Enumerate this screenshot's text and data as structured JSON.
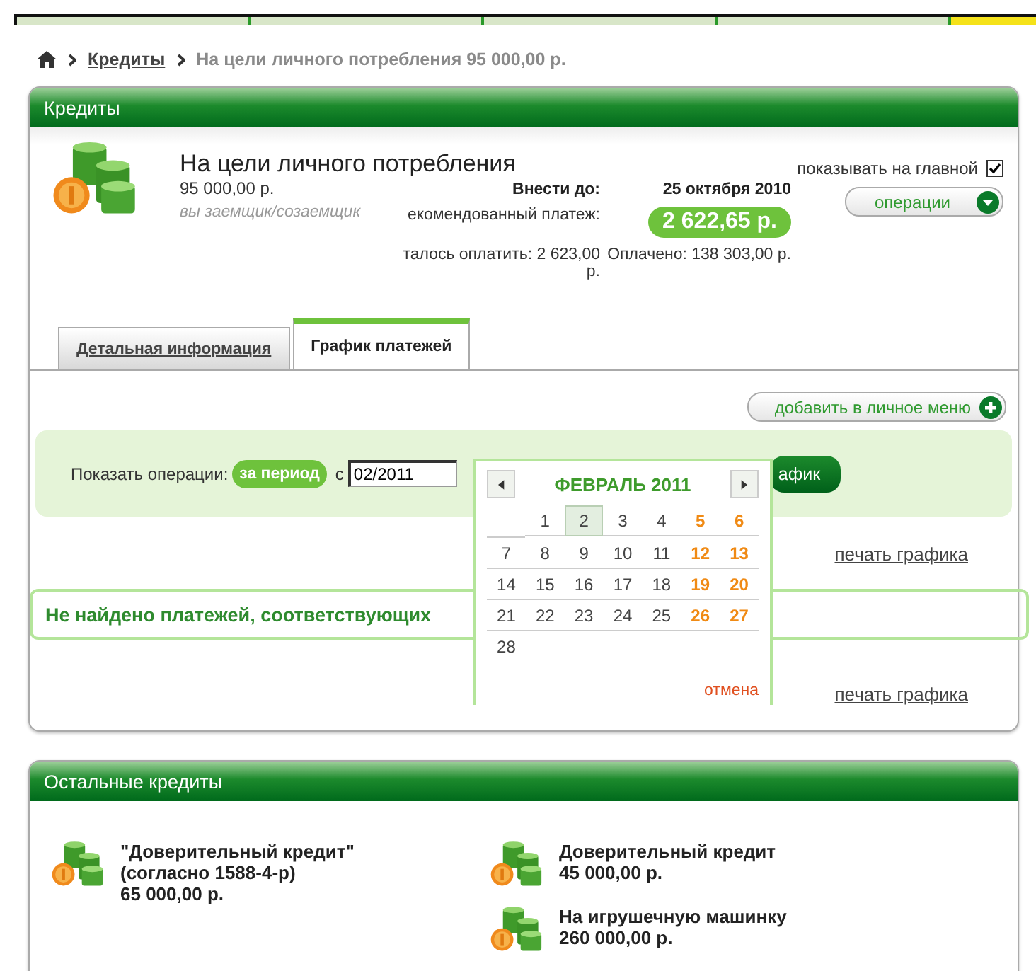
{
  "breadcrumb": {
    "link": "Кредиты",
    "current": "На цели личного потребления 95 000,00 р."
  },
  "panel_title": "Кредиты",
  "loan": {
    "title": "На цели личного потребления",
    "amount": "95 000,00 р.",
    "role": "вы заемщик/созаемщик",
    "info": [
      {
        "label": "Внести до:",
        "value": "25 октября 2010",
        "kind": "bold"
      },
      {
        "label": "екомендованный платеж:",
        "value": "2 622,65 р.",
        "kind": "badge"
      },
      {
        "label": "талось оплатить: 2 623,00 р.",
        "value": "Оплачено: 138 303,00 р.",
        "kind": "plain"
      }
    ],
    "show_on_main": {
      "label": "показывать на главной",
      "checked": true
    },
    "operations_button": "операции"
  },
  "tabs": [
    {
      "label": "Детальная информация",
      "selected": false
    },
    {
      "label": "График платежей",
      "selected": true
    }
  ],
  "add_menu_button": "добавить в личное меню",
  "filter": {
    "label": "Показать операции:",
    "period_chip": "за период",
    "from_label": "с",
    "from_value": "02/2011",
    "show_button": "афик"
  },
  "print_links": [
    "печать графика",
    "печать графика"
  ],
  "message": "Не найдено платежей, соответствующих",
  "calendar": {
    "title": "ФЕВРАЛЬ 2011",
    "cancel": "отмена",
    "weeks": [
      {
        "days": [
          {
            "text": "1",
            "weekend": false,
            "selected": false
          },
          {
            "text": "2",
            "weekend": false,
            "selected": true
          },
          {
            "text": "3",
            "weekend": false,
            "selected": false
          },
          {
            "text": "4",
            "weekend": false,
            "selected": false
          },
          {
            "text": "5",
            "weekend": true,
            "selected": false
          },
          {
            "text": "6",
            "weekend": true,
            "selected": false
          }
        ]
      },
      {
        "days": [
          {
            "text": "7",
            "weekend": false,
            "selected": false
          },
          {
            "text": "8",
            "weekend": false,
            "selected": false
          },
          {
            "text": "9",
            "weekend": false,
            "selected": false
          },
          {
            "text": "10",
            "weekend": false,
            "selected": false
          },
          {
            "text": "11",
            "weekend": false,
            "selected": false
          },
          {
            "text": "12",
            "weekend": true,
            "selected": false
          },
          {
            "text": "13",
            "weekend": true,
            "selected": false
          }
        ]
      },
      {
        "days": [
          {
            "text": "14",
            "weekend": false,
            "selected": false
          },
          {
            "text": "15",
            "weekend": false,
            "selected": false
          },
          {
            "text": "16",
            "weekend": false,
            "selected": false
          },
          {
            "text": "17",
            "weekend": false,
            "selected": false
          },
          {
            "text": "18",
            "weekend": false,
            "selected": false
          },
          {
            "text": "19",
            "weekend": true,
            "selected": false
          },
          {
            "text": "20",
            "weekend": true,
            "selected": false
          }
        ]
      },
      {
        "days": [
          {
            "text": "21",
            "weekend": false,
            "selected": false
          },
          {
            "text": "22",
            "weekend": false,
            "selected": false
          },
          {
            "text": "23",
            "weekend": false,
            "selected": false
          },
          {
            "text": "24",
            "weekend": false,
            "selected": false
          },
          {
            "text": "25",
            "weekend": false,
            "selected": false
          },
          {
            "text": "26",
            "weekend": true,
            "selected": false
          },
          {
            "text": "27",
            "weekend": true,
            "selected": false
          }
        ]
      },
      {
        "days": [
          {
            "text": "28",
            "weekend": false,
            "selected": false
          }
        ]
      }
    ]
  },
  "other_loans": {
    "title": "Остальные кредиты",
    "columns": [
      {
        "items": [
          {
            "name": "\"Доверительный кредит\" (согласно 1588-4-р)",
            "amount": "65 000,00 р."
          }
        ]
      },
      {
        "items": [
          {
            "name": "Доверительный кредит",
            "amount": "45 000,00 р."
          },
          {
            "name": "На игрушечную машинку",
            "amount": "260 000,00 р."
          }
        ]
      }
    ]
  }
}
